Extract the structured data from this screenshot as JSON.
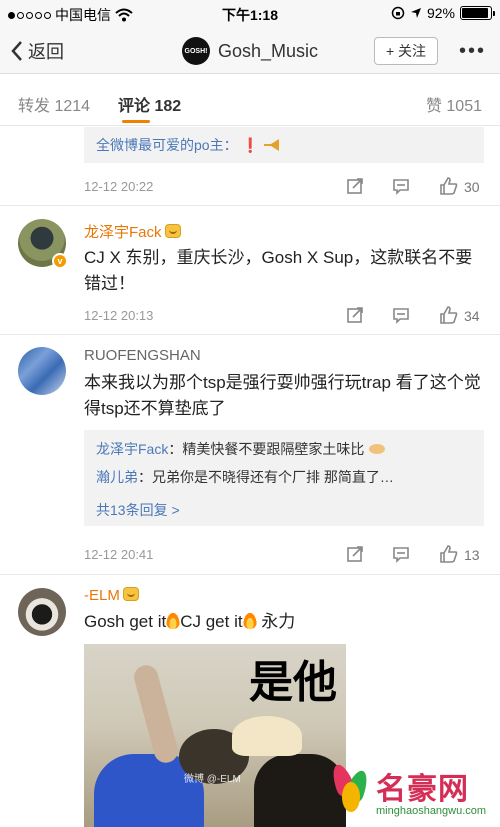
{
  "status_bar": {
    "carrier": "中国电信",
    "time": "下午1:18",
    "battery": "92%",
    "battery_level": 0.92
  },
  "nav": {
    "back_label": "返回",
    "logo_text": "GOSH!",
    "title": "Gosh_Music",
    "follow_label": "+ 关注",
    "more_label": "•••"
  },
  "tabs": {
    "repost": "转发 1214",
    "comments": "评论 182",
    "likes": "赞 1051"
  },
  "prev_reply_text": "全微博最可爱的po主：",
  "prev_reply_mark": "❗",
  "comments": [
    {
      "time": "12-12 20:22",
      "likes": "30"
    },
    {
      "name": "龙泽宇Fack",
      "text": "CJ X 东别，重庆长沙，Gosh X Sup，这款联名不要错过！",
      "time": "12-12 20:13",
      "likes": "34"
    },
    {
      "name": "RUOFENGSHAN",
      "text": "本来我以为那个tsp是强行耍帅强行玩trap 看了这个觉得tsp还不算垫底了",
      "replies": [
        {
          "who": "龙泽宇Fack",
          "text": "：精美快餐不要跟隔壁家土味比"
        },
        {
          "who": "瀚儿弟",
          "text": "：兄弟你是不晓得还有个厂排 那简直了…"
        }
      ],
      "more_replies": "共13条回复 >",
      "time": "12-12 20:41",
      "likes": "13"
    },
    {
      "name": "-ELM",
      "text_parts": [
        "Gosh get it",
        "CJ get it",
        " 永力"
      ],
      "meme_caption": "是他",
      "meme_watermark": "微博 @-ELM"
    }
  ],
  "watermark": {
    "name": "名豪网",
    "url": "minghaoshangwu.com"
  }
}
